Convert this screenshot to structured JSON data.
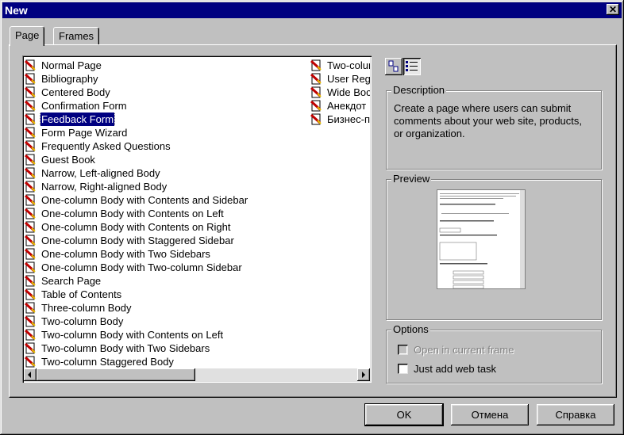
{
  "window": {
    "title": "New",
    "close_label": "✕"
  },
  "tabs": [
    {
      "label": "Page"
    },
    {
      "label": "Frames"
    }
  ],
  "list": {
    "col1": [
      "Normal Page",
      "Bibliography",
      "Centered Body",
      "Confirmation Form",
      "Feedback Form",
      "Form Page Wizard",
      "Frequently Asked Questions",
      "Guest Book",
      "Narrow, Left-aligned Body",
      "Narrow, Right-aligned Body",
      "One-column Body with Contents and Sidebar",
      "One-column Body with Contents on Left",
      "One-column Body with Contents on Right",
      "One-column Body with Staggered Sidebar",
      "One-column Body with Two Sidebars",
      "One-column Body with Two-column Sidebar",
      "Search Page",
      "Table of Contents",
      "Three-column Body",
      "Two-column Body",
      "Two-column Body with Contents on Left",
      "Two-column Body with Two Sidebars",
      "Two-column Staggered Body"
    ],
    "col2": [
      "Two-colum",
      "User Reg",
      "Wide Boc",
      "Анекдот",
      "Бизнес-п"
    ],
    "selected": "Feedback Form"
  },
  "description": {
    "label": "Description",
    "text": "Create a page where users can submit comments about your web site, products, or organization."
  },
  "preview": {
    "label": "Preview"
  },
  "options": {
    "label": "Options",
    "open_in_frame": "Open in current frame",
    "just_add_task": "Just add web task"
  },
  "buttons": {
    "ok": "OK",
    "cancel": "Отмена",
    "help": "Справка"
  }
}
